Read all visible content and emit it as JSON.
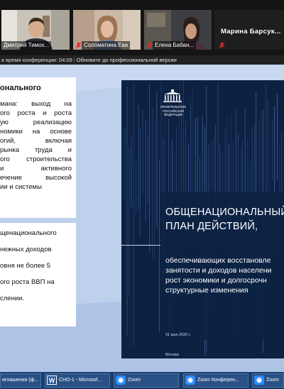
{
  "participants": [
    {
      "name": "Дмитрий Тимох...",
      "muted": false
    },
    {
      "name": "Соломатина Ева",
      "muted": true
    },
    {
      "name": "Елена Бабан...",
      "muted": true
    },
    {
      "name": "Марина Барсук...",
      "muted": true
    }
  ],
  "notice_bar": {
    "time_text": "в время конференции: 04:09",
    "upgrade_link": "Обновите до профессиональной версии"
  },
  "slide": {
    "heading": "онального",
    "box1_lines": [
      "мана:  выход  на",
      "ого роста и роста",
      "ую  реализацию",
      "номики на основе",
      "огий,     включая",
      "рынка  труда  и",
      "ого строительства",
      "и        активного",
      "ечение  высокой",
      "ии       и   системы"
    ],
    "box2_lines": [
      "щенационального",
      "нежных доходов",
      "овня не более 5",
      "ого роста ВВП на",
      "слении."
    ]
  },
  "document_cover": {
    "issuer_lines": [
      "ПРАВИТЕЛЬСТВО",
      "РОССИЙСКОЙ",
      "ФЕДЕРАЦИИ"
    ],
    "title_lines": [
      "ОБЩЕНАЦИОНАЛЬНЫЙ",
      "ПЛАН ДЕЙСТВИЙ,"
    ],
    "subtitle_lines": [
      "обеспечивающих восстановле",
      "занятости и доходов населени",
      "рост экономики и долгосрочн",
      "структурные изменения"
    ],
    "date": "31 мая 2020 г.",
    "city": "Москва"
  },
  "taskbar": {
    "items": [
      {
        "label": "иглашения (ф...",
        "icon": "folder-icon"
      },
      {
        "label": "CHO-1 - Microsof...",
        "icon": "word-icon"
      },
      {
        "label": "Zoom",
        "icon": "zoom-icon"
      },
      {
        "label": "Zoom Конферен...",
        "icon": "zoom-icon"
      },
      {
        "label": "Zoom",
        "icon": "zoom-icon"
      }
    ]
  },
  "colors": {
    "slide_background": "#bdd0ec",
    "document_navy": "#0d2243",
    "taskbar": "#1a3c68",
    "mic_muted_red": "#e02828"
  }
}
